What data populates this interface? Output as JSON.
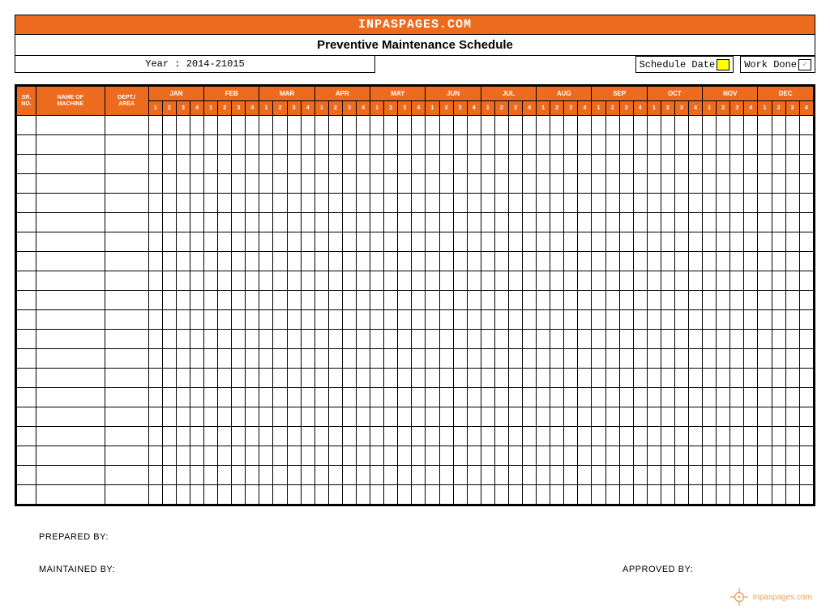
{
  "site_banner": "INPASPAGES.COM",
  "title": "Preventive Maintenance Schedule",
  "year_label": "Year : 2014-21015",
  "legend": {
    "schedule_label": "Schedule Date",
    "workdone_label": "Work Done"
  },
  "columns": {
    "sr": "SR.\nNO.",
    "name": "NAME OF\nMACHINE",
    "dept": "DEPT./\nAREA"
  },
  "months": [
    "JAN",
    "FEB",
    "MAR",
    "APR",
    "MAY",
    "JUN",
    "JUL",
    "AUG",
    "SEP",
    "OCT",
    "NOV",
    "DEC"
  ],
  "weeks": [
    "1",
    "2",
    "3",
    "4"
  ],
  "body_row_count": 20,
  "footer": {
    "prepared": "PREPARED BY:",
    "maintained": "MAINTAINED BY:",
    "approved": "APPROVED BY:"
  },
  "watermark_text": "Inpaspages.com"
}
